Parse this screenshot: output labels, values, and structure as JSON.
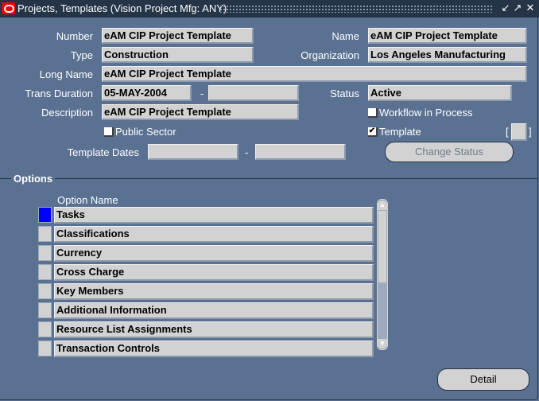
{
  "window": {
    "title": "Projects, Templates (Vision Project Mfg: ANY)",
    "controls": [
      "minimize-icon",
      "maximize-icon",
      "close-icon"
    ],
    "minimize_glyph": "↙",
    "maximize_glyph": "↗",
    "close_glyph": "✕"
  },
  "form": {
    "number": {
      "label": "Number",
      "value": "eAM CIP Project Template"
    },
    "name": {
      "label": "Name",
      "value": "eAM CIP Project Template"
    },
    "type": {
      "label": "Type",
      "value": "Construction"
    },
    "organization": {
      "label": "Organization",
      "value": "Los Angeles Manufacturing"
    },
    "long_name": {
      "label": "Long Name",
      "value": "eAM CIP Project Template"
    },
    "trans_duration": {
      "label": "Trans Duration",
      "from": "05-MAY-2004",
      "to": "",
      "separator": "-"
    },
    "status": {
      "label": "Status",
      "value": "Active"
    },
    "description": {
      "label": "Description",
      "value": "eAM CIP Project Template"
    },
    "workflow_in_process": {
      "label": "Workflow in Process",
      "checked": false
    },
    "public_sector": {
      "label": "Public Sector",
      "checked": false
    },
    "template": {
      "label": "Template",
      "checked": true,
      "check_glyph": "✔"
    },
    "template_dates": {
      "label": "Template Dates",
      "from": "",
      "to": "",
      "separator": "-"
    },
    "flex_field": {
      "open": "[",
      "close": "]",
      "value": ""
    },
    "change_status_button": "Change Status"
  },
  "options": {
    "section_title": "Options",
    "column_header": "Option Name",
    "rows": [
      {
        "name": "Tasks",
        "selected": true
      },
      {
        "name": "Classifications",
        "selected": false
      },
      {
        "name": "Currency",
        "selected": false
      },
      {
        "name": "Cross Charge",
        "selected": false
      },
      {
        "name": "Key Members",
        "selected": false
      },
      {
        "name": "Additional Information",
        "selected": false
      },
      {
        "name": "Resource List Assignments",
        "selected": false
      },
      {
        "name": "Transaction Controls",
        "selected": false
      }
    ],
    "scroll_up_glyph": "▲",
    "scroll_down_glyph": "▼"
  },
  "detail_button": "Detail",
  "colors": {
    "background": "#5a7191",
    "titlebar": "#253447",
    "field": "#d2d2d2",
    "selected_row": "#0000ff",
    "logo": "#ee0000"
  }
}
